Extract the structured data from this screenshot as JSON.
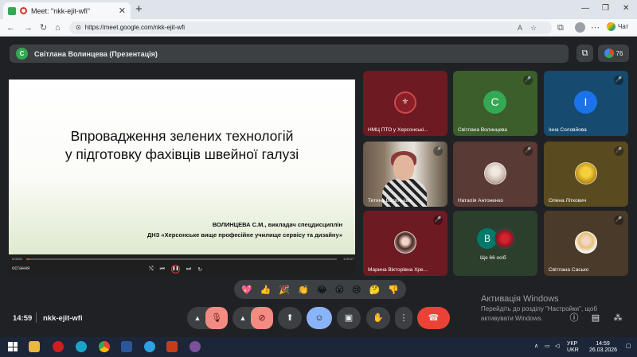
{
  "browser": {
    "tab_title": "Meet: \"nkk-ejit-wfi\"",
    "tab_close": "✕",
    "new_tab": "+",
    "win_min": "—",
    "win_max": "❐",
    "win_close": "✕",
    "url": "https://meet.google.com/nkk-ejit-wfi",
    "chat_label": "Чат"
  },
  "meet": {
    "presenter_initial": "С",
    "presenter_label": "Світлана Волинцева (Презентація)",
    "participant_count": "76",
    "presentation": {
      "title_line1": "Впровадження зелених технологій",
      "title_line2": "у підготовку фахівців швейної галузі",
      "author_line1": "ВОЛИНЦЕВА С.М., викладач спецдисциплін",
      "author_line2": "ДНЗ «Херсонське вище професійне училище сервісу та дизайну»",
      "time_start": "0:02/01",
      "time_end": "1:20:17",
      "progress": 0.01,
      "bottom_name": "остання"
    },
    "tiles": [
      {
        "name": "НМЦ ПТО у Херсонські...",
        "color": "#6e1a22"
      },
      {
        "name": "Світлана Волинцева",
        "color": "#3b5e2b",
        "initial": "С",
        "avatar_color": "#34a853"
      },
      {
        "name": "Інна Соловйова",
        "color": "#164a6e",
        "initial": "І",
        "avatar_color": "#1a73e8"
      },
      {
        "name": "Тетяна Васильєва"
      },
      {
        "name": "Наталія Антоненко",
        "color": "#5a3a34"
      },
      {
        "name": "Олена Літкович",
        "color": "#5a4a20"
      },
      {
        "name": "Марина Вікторівна Хре...",
        "color": "#6e1a22"
      },
      {
        "name": "Ще 66 осіб",
        "color": "#2c3e2c",
        "initial": "В"
      },
      {
        "name": "Світлана Сасько",
        "color": "#4a3a2a"
      }
    ],
    "reactions": [
      "💖",
      "👍",
      "🎉",
      "👏",
      "😂",
      "😮",
      "😢",
      "🤔",
      "👎"
    ],
    "time": "14:59",
    "meeting_code": "nkk-ejit-wfi",
    "windows_activation": {
      "title": "Активація Windows",
      "line1": "Перейдіть до розділу \"Настройки\", щоб",
      "line2": "активувати Windows."
    }
  },
  "taskbar": {
    "lang1": "УКР",
    "lang2": "UKR",
    "clock": "14:59",
    "date": "26.03.2026"
  }
}
